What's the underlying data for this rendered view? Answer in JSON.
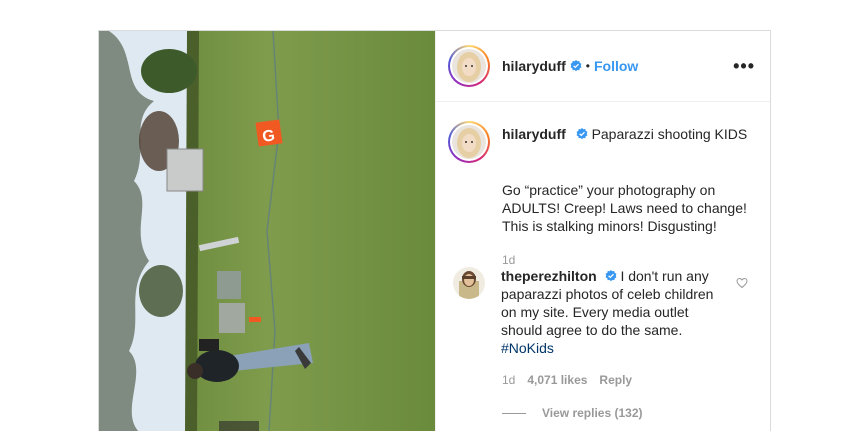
{
  "post": {
    "username": "hilaryduff",
    "follow_label": "Follow",
    "separator": "•",
    "more_label": "•••"
  },
  "caption": {
    "username": "hilaryduff",
    "headline": "Paparazzi shooting KIDS",
    "body": "Go “practice” your photography on ADULTS! Creep! Laws need to change! This is stalking minors! Disgusting!",
    "time": "1d"
  },
  "comment": {
    "username": "theperezhilton",
    "text": "I don't run any paparazzi photos of celeb children on my site. Every media outlet should agree to do the same.",
    "hashtag": "#NoKids",
    "time": "1d",
    "likes": "4,071 likes",
    "reply_label": "Reply",
    "view_replies": "View replies (132)"
  },
  "icons": {
    "verified": "verified-badge-icon",
    "heart": "heart-outline-icon",
    "more": "more-options-icon"
  },
  "colors": {
    "link": "#3897f0",
    "verified": "#3897f0",
    "muted": "#999999",
    "hashtag": "#003569"
  }
}
